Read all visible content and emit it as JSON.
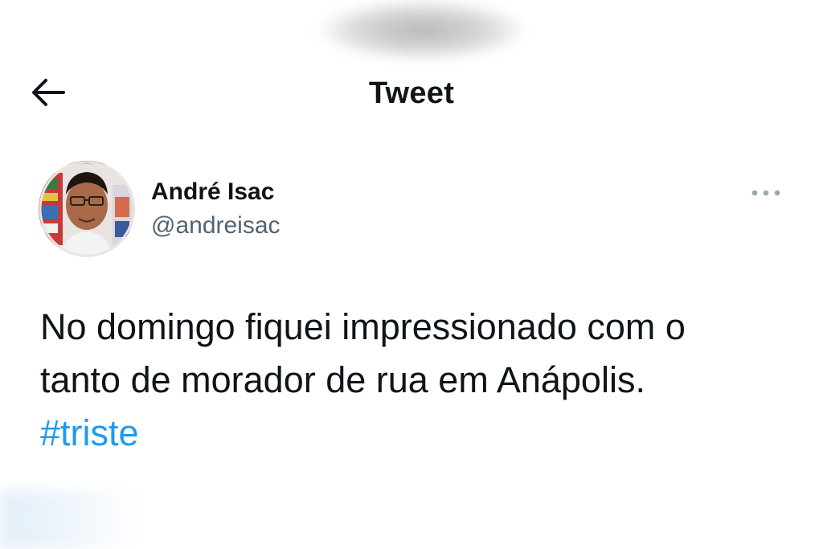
{
  "header": {
    "title": "Tweet",
    "back_icon": "arrow-left-icon"
  },
  "author": {
    "name": "André Isac",
    "handle": "@andreisac",
    "avatar_icon": "user-avatar",
    "more_icon": "ellipsis-icon"
  },
  "tweet": {
    "line1": "No domingo fiquei impressionado com o",
    "line2": "tanto de morador de rua em Anápolis.",
    "hashtag": "#triste"
  },
  "colors": {
    "text": "#0f1419",
    "secondary": "#536471",
    "link": "#1d9bf0",
    "background": "#ffffff"
  }
}
